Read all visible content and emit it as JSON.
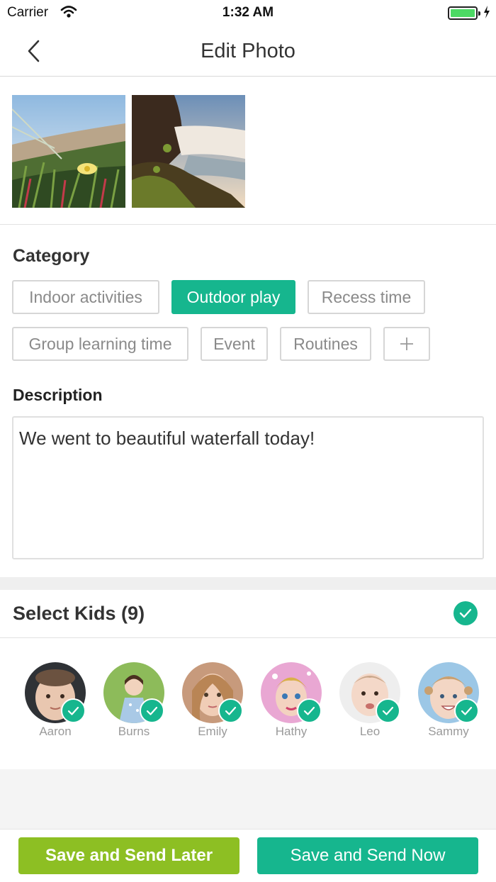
{
  "status_bar": {
    "carrier": "Carrier",
    "time": "1:32 AM"
  },
  "nav": {
    "title": "Edit Photo"
  },
  "category": {
    "title": "Category",
    "chips": [
      {
        "label": "Indoor activities",
        "selected": false
      },
      {
        "label": "Outdoor play",
        "selected": true
      },
      {
        "label": "Recess time",
        "selected": false
      },
      {
        "label": "Group learning time",
        "selected": false
      },
      {
        "label": "Event",
        "selected": false
      },
      {
        "label": "Routines",
        "selected": false
      }
    ],
    "add_icon": "plus-icon"
  },
  "description": {
    "title": "Description",
    "value": "We went to beautiful waterfall today!"
  },
  "kids": {
    "title": "Select Kids (9)",
    "items": [
      {
        "name": "Aaron",
        "checked": true
      },
      {
        "name": "Burns",
        "checked": true
      },
      {
        "name": "Emily",
        "checked": true
      },
      {
        "name": "Hathy",
        "checked": true
      },
      {
        "name": "Leo",
        "checked": true
      },
      {
        "name": "Sammy",
        "checked": true
      }
    ]
  },
  "actions": {
    "save_later": "Save and Send Later",
    "save_now": "Save and Send Now"
  },
  "colors": {
    "accent": "#16b68e",
    "lime": "#8dbf23"
  }
}
